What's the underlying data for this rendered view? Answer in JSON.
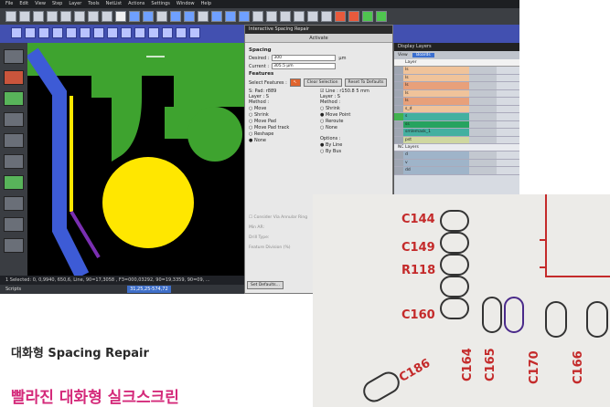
{
  "menu": [
    "File",
    "Edit",
    "View",
    "Step",
    "Layer",
    "Tools",
    "NetList",
    "Actions",
    "Settings",
    "Window",
    "Help"
  ],
  "dialog": {
    "title": "Interactive Spacing Repair",
    "tab": "Activate",
    "spacing_heading": "Spacing",
    "desired_label": "Desired :",
    "desired_value": "300",
    "desired_unit": "μm",
    "current_label": "Current :",
    "current_value": "305.5 μm",
    "features_heading": "Features",
    "select_features_label": "Select Features :",
    "clear_selection": "Clear Selection",
    "reset_defaults": "Reset To Defaults",
    "left_feature": "S: Pad: r889",
    "right_feature": "Line : r150.8 5 mm",
    "left_layer": "Layer : S",
    "right_layer": "Layer : S",
    "method_label": "Method :",
    "left_methods": [
      "Move",
      "Shrink",
      "Move Pad",
      "Move Pad track",
      "Reshape",
      "None"
    ],
    "left_selected": "None",
    "right_methods": [
      "Shrink",
      "Move Point",
      "Reroute",
      "None"
    ],
    "right_selected": "Move Point",
    "options_label": "Options :",
    "option_by_line": "By Line",
    "option_by_bus": "By Bus",
    "consider_via": "Consider Via Annular Ring",
    "min_ar": "Min AR:",
    "drill_type": "Drill Type:",
    "feature_division": "Feature Division (%)",
    "set_defaults": "Set Defaults..."
  },
  "layers": {
    "title": "Display Layers",
    "view_label": "View",
    "view_value": "Boards",
    "column_header": "Layer",
    "rows": [
      {
        "name": "ls",
        "color": "#f0c39a",
        "selected": false
      },
      {
        "name": "ls",
        "color": "#f0c39a",
        "selected": false
      },
      {
        "name": "ls",
        "color": "#e8a07a",
        "selected": false
      },
      {
        "name": "ls",
        "color": "#f0c39a",
        "selected": false
      },
      {
        "name": "ls",
        "color": "#e8a07a",
        "selected": false
      },
      {
        "name": "s_d",
        "color": "#f0c39a",
        "selected": false
      },
      {
        "name": "s",
        "color": "#43b0a0",
        "selected": true
      },
      {
        "name": "ss",
        "color": "#26a35f",
        "selected": false
      },
      {
        "name": "smlemask_1",
        "color": "#43b0a0",
        "selected": false
      },
      {
        "name": "pst",
        "color": "#cfd7a0",
        "selected": false
      }
    ],
    "nc_heading": "NC Layers",
    "nc_rows": [
      {
        "name": "d",
        "color": "#9fb4c9"
      },
      {
        "name": "v",
        "color": "#9fb4c9"
      },
      {
        "name": "dd",
        "color": "#9fb4c9"
      }
    ]
  },
  "status": {
    "selected": "1 Selected: 0,  0,9940, 650,6,  Line,  90=17,3058 ,  F3=000,03292,  90=19,3359,  90=09,  ...",
    "footer_label": "Scripts",
    "coords": "31,25,25-574,72"
  },
  "photo": {
    "labels": [
      "C144",
      "C149",
      "R118",
      "C160",
      "C164",
      "C165",
      "C170",
      "C166",
      "C186"
    ]
  },
  "captions": {
    "line1": "대화형 Spacing Repair",
    "line2": "빨라진 대화형 실크스크린"
  },
  "colors": {
    "copper": "#3ea32f",
    "pad_yellow": "#ffe700",
    "trace_blue": "#3d5bd6",
    "silk_red": "#c42a2a",
    "caption_pink": "#d42a7a"
  }
}
